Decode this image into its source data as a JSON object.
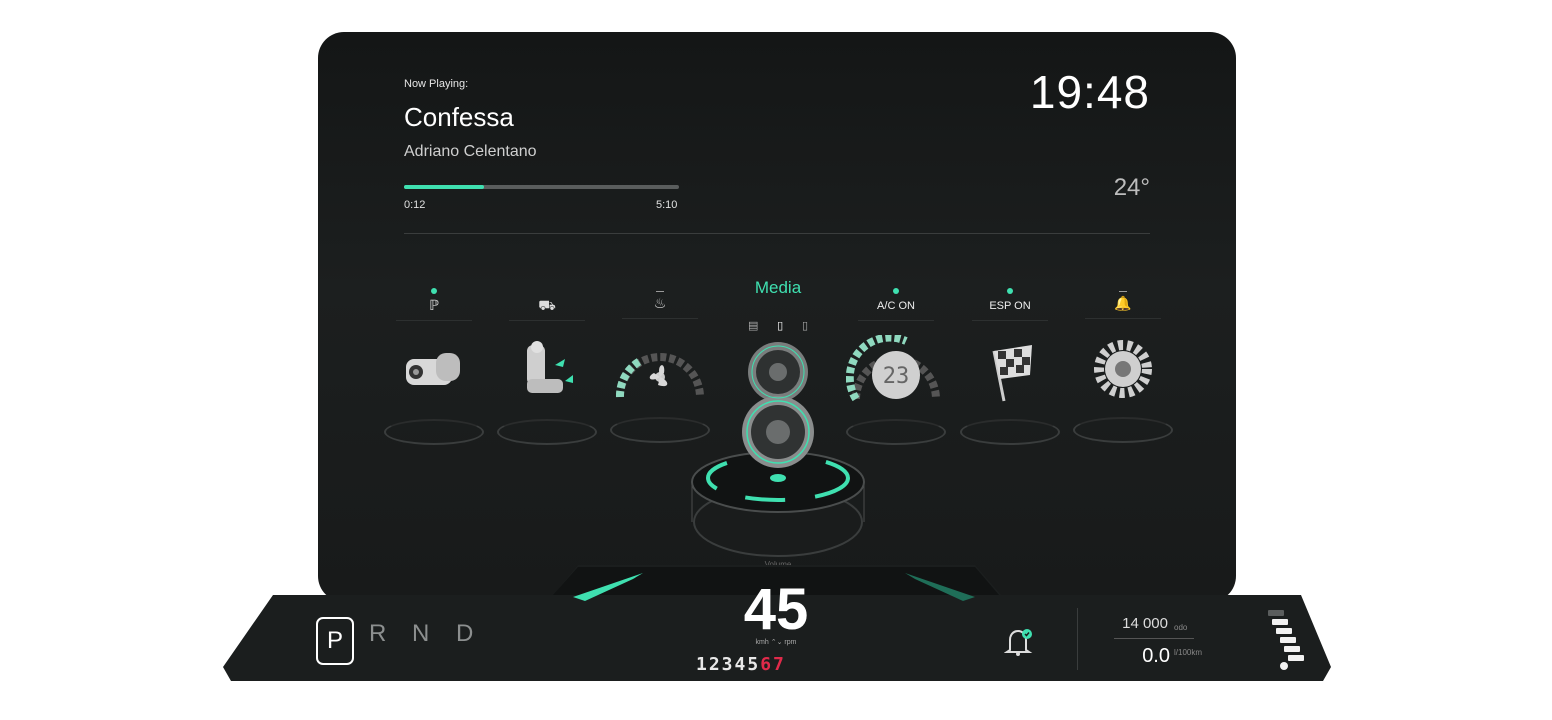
{
  "now_playing": {
    "label": "Now Playing:",
    "title": "Confessa",
    "artist": "Adriano Celentano",
    "elapsed": "0:12",
    "duration": "5:10",
    "progress_percent": 29
  },
  "clock": "19:48",
  "temperature": "24°",
  "media": {
    "title": "Media",
    "sources": [
      "radio-icon",
      "phone-icon",
      "tablet-icon"
    ],
    "volume_label": "Volume"
  },
  "tiles": [
    {
      "key": "parking",
      "icon": "parking-sensor-icon",
      "icon_glyph": "ℙ",
      "status": "dot",
      "label": "",
      "art": "camera"
    },
    {
      "key": "seat",
      "icon": "car-icon",
      "icon_glyph": "⛟",
      "status": "none",
      "label": "",
      "art": "seat"
    },
    {
      "key": "fan",
      "icon": "heater-icon",
      "icon_glyph": "♨",
      "status": "dash",
      "label": "",
      "art": "fan"
    },
    {
      "key": "ac",
      "icon": "ac-icon",
      "icon_glyph": "",
      "status": "dot",
      "label": "A/C ON",
      "art": "temp",
      "art_value": "23"
    },
    {
      "key": "esp",
      "icon": "esp-icon",
      "icon_glyph": "",
      "status": "dot",
      "label": "ESP ON",
      "art": "flag"
    },
    {
      "key": "alerts",
      "icon": "bell-icon",
      "icon_glyph": "🔔",
      "status": "dash",
      "label": "",
      "art": "gear"
    }
  ],
  "cluster": {
    "gears": [
      "P",
      "R",
      "N",
      "D"
    ],
    "selected_gear": "P",
    "speed": "45",
    "units": "kmh ⌃⌄ rpm",
    "gear_indicator_white": "12345",
    "gear_indicator_red": "67",
    "odometer": "14 000",
    "odometer_unit": "odo",
    "consumption": "0.0",
    "consumption_unit": "l/100km",
    "fuel_level_fraction": 0.85,
    "colors": {
      "accent": "#3fe0b0",
      "redline": "#e02a4a"
    }
  }
}
